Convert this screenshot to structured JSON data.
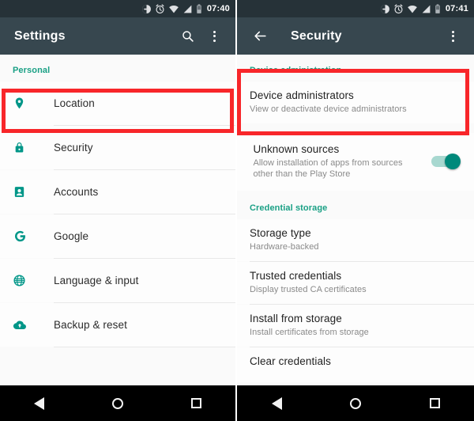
{
  "status_bar": {
    "icons": [
      "dnd-icon",
      "alarm-icon",
      "wifi-icon",
      "signal-icon",
      "battery-icon"
    ],
    "left_time": "07:40",
    "right_time": "07:41"
  },
  "colors": {
    "toolbar": "#37474f",
    "statusbar": "#263238",
    "accent_teal": "#1aa085",
    "icon_teal": "#009688",
    "highlight_red": "#f8262a",
    "toggle_on": "#00897b"
  },
  "left_panel": {
    "toolbar": {
      "title": "Settings",
      "search_icon": "search-icon",
      "overflow_icon": "overflow-menu-icon"
    },
    "section_header": "Personal",
    "items": [
      {
        "label": "Location",
        "icon": "location-pin-icon",
        "highlighted": false
      },
      {
        "label": "Security",
        "icon": "lock-icon",
        "highlighted": true
      },
      {
        "label": "Accounts",
        "icon": "account-icon",
        "highlighted": false
      },
      {
        "label": "Google",
        "icon": "google-g-icon",
        "highlighted": false
      },
      {
        "label": "Language & input",
        "icon": "globe-icon",
        "highlighted": false
      },
      {
        "label": "Backup & reset",
        "icon": "cloud-upload-icon",
        "highlighted": false
      }
    ]
  },
  "right_panel": {
    "toolbar": {
      "title": "Security",
      "back_icon": "arrow-back-icon",
      "overflow_icon": "overflow-menu-icon"
    },
    "sections": [
      {
        "header": "Device administration",
        "items": [
          {
            "title": "Device administrators",
            "subtitle": "View or deactivate device administrators",
            "toggle": null,
            "highlighted": false
          },
          {
            "title": "Unknown sources",
            "subtitle": "Allow installation of apps from sources other than the Play Store",
            "toggle": "on",
            "highlighted": true
          }
        ]
      },
      {
        "header": "Credential storage",
        "items": [
          {
            "title": "Storage type",
            "subtitle": "Hardware-backed",
            "toggle": null,
            "highlighted": false
          },
          {
            "title": "Trusted credentials",
            "subtitle": "Display trusted CA certificates",
            "toggle": null,
            "highlighted": false
          },
          {
            "title": "Install from storage",
            "subtitle": "Install certificates from storage",
            "toggle": null,
            "highlighted": false
          },
          {
            "title": "Clear credentials",
            "subtitle": "",
            "toggle": null,
            "highlighted": false
          }
        ]
      }
    ]
  },
  "nav_bar": {
    "buttons": [
      {
        "name": "nav-back-button",
        "icon": "triangle-back-icon"
      },
      {
        "name": "nav-home-button",
        "icon": "circle-home-icon"
      },
      {
        "name": "nav-recents-button",
        "icon": "square-recents-icon"
      }
    ]
  }
}
